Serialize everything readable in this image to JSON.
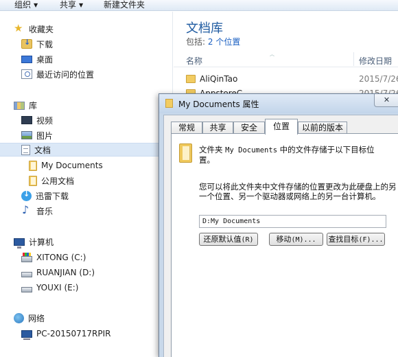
{
  "toolbar": {
    "organize": "组织",
    "share": "共享",
    "new_folder": "新建文件夹"
  },
  "nav": {
    "favorites": "收藏夹",
    "downloads": "下载",
    "desktop": "桌面",
    "recent": "最近访问的位置",
    "libraries": "库",
    "videos": "视频",
    "pictures": "图片",
    "documents": "文档",
    "my_documents": "My Documents",
    "public_documents": "公用文档",
    "thunder_downloads": "迅雷下载",
    "music": "音乐",
    "computer": "计算机",
    "drive_c": "XITONG (C:)",
    "drive_d": "RUANJIAN (D:)",
    "drive_e": "YOUXI (E:)",
    "network": "网络",
    "network_pc": "PC-20150717RPIR"
  },
  "library": {
    "title": "文档库",
    "includes_label": "包括:",
    "locations_link": "2 个位置",
    "col_name": "名称",
    "col_modified": "修改日期",
    "rows": [
      {
        "name": "AliQinTao",
        "date": "2015/7/26"
      },
      {
        "name": "AppstoreC",
        "date": "2015/7/26"
      }
    ]
  },
  "dialog": {
    "title": "My Documents 属性",
    "close": "✕",
    "tabs": [
      "常规",
      "共享",
      "安全",
      "位置",
      "以前的版本"
    ],
    "active_tab": "位置",
    "desc1_a": "文件夹 ",
    "desc1_mono": "My Documents",
    "desc1_b": " 中的文件存储于以下目标位置。",
    "desc2": "您可以将此文件夹中文件存储的位置更改为此硬盘上的另一个位置、另一个驱动器或网络上的另一台计算机。",
    "path": "D:My Documents",
    "btn_restore_label": "还原默认值",
    "btn_restore_key": "(R)",
    "btn_move_label": "移动",
    "btn_move_key": "(M)...",
    "btn_find_label": "查找目标",
    "btn_find_key": "(F)..."
  }
}
